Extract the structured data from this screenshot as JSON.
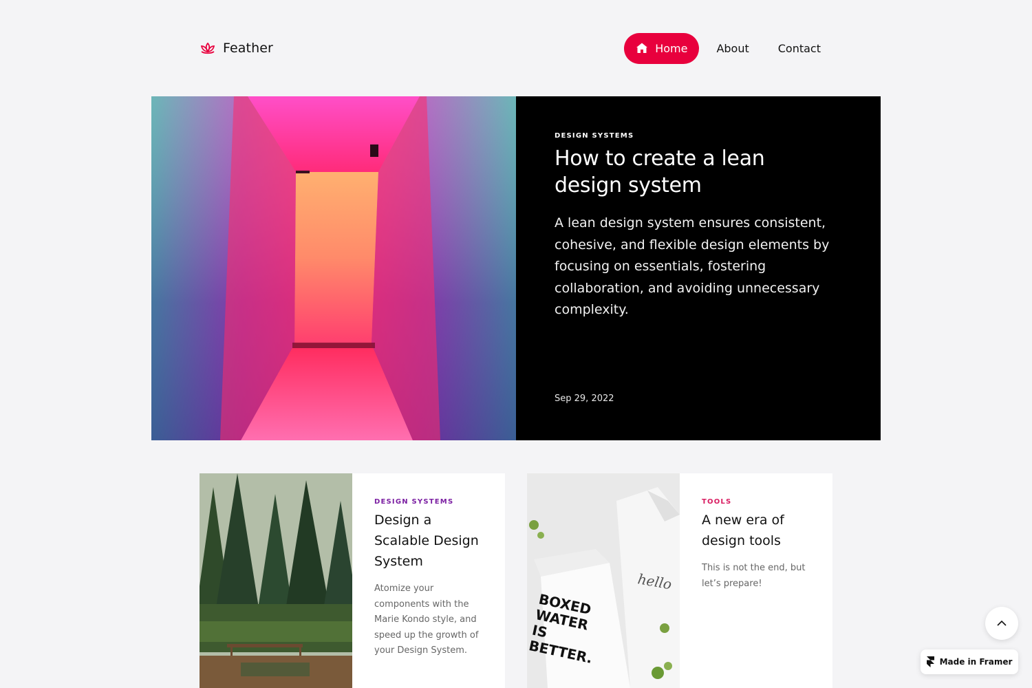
{
  "brand": {
    "name": "Feather",
    "icon": "lotus-icon",
    "color": "#e8003d"
  },
  "nav": {
    "items": [
      {
        "label": "Home",
        "icon": "home-icon",
        "active": true
      },
      {
        "label": "About"
      },
      {
        "label": "Contact"
      }
    ],
    "active_color": "#e8003d"
  },
  "hero": {
    "tag": "DESIGN SYSTEMS",
    "title": "How to create a lean design system",
    "description": "A lean design system ensures consistent, cohesive, and flexible design elements by focusing on essentials, fostering collaboration, and avoiding unnecessary complexity.",
    "date": "Sep 29, 2022",
    "image": "neon-corridor-image"
  },
  "cards": [
    {
      "tag": "DESIGN SYSTEMS",
      "tag_color": "#7b1fa2",
      "title": "Design a Scalable Design System",
      "description": "Atomize your components with the Marie Kondo style, and speed up the growth of your Design System.",
      "image": "forest-image"
    },
    {
      "tag": "TOOLS",
      "tag_color": "#d81b60",
      "title": "A new era of design tools",
      "description": "This is not the end, but let’s prepare!",
      "image": "milk-carton-image"
    }
  ],
  "floating": {
    "scroll_top_icon": "chevron-up-icon",
    "badge_label": "Made in Framer",
    "badge_icon": "framer-logo-icon"
  }
}
